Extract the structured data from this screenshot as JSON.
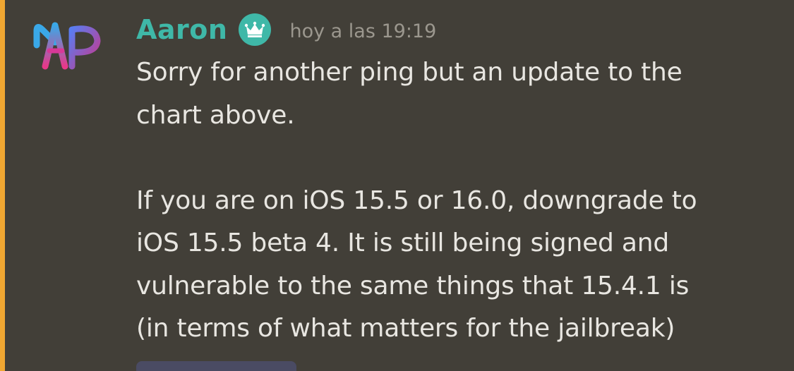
{
  "colors": {
    "background": "#423f38",
    "highlight_bar": "#f0a732",
    "username": "#3fb8a8",
    "timestamp": "#9b978e",
    "text": "#e8e6e1",
    "embed": "#4a4b63"
  },
  "message": {
    "author": "Aaron",
    "badge_icon": "crown-icon",
    "timestamp": "hoy a las 19:19",
    "lines": [
      "Sorry for another ping but an update to the",
      "chart above.",
      "",
      "If you are on iOS 15.5 or 16.0, downgrade to",
      "iOS 15.5 beta 4. It is still being signed and",
      "vulnerable to the same things that 15.4.1 is",
      "(in terms of what matters for the jailbreak)"
    ]
  }
}
